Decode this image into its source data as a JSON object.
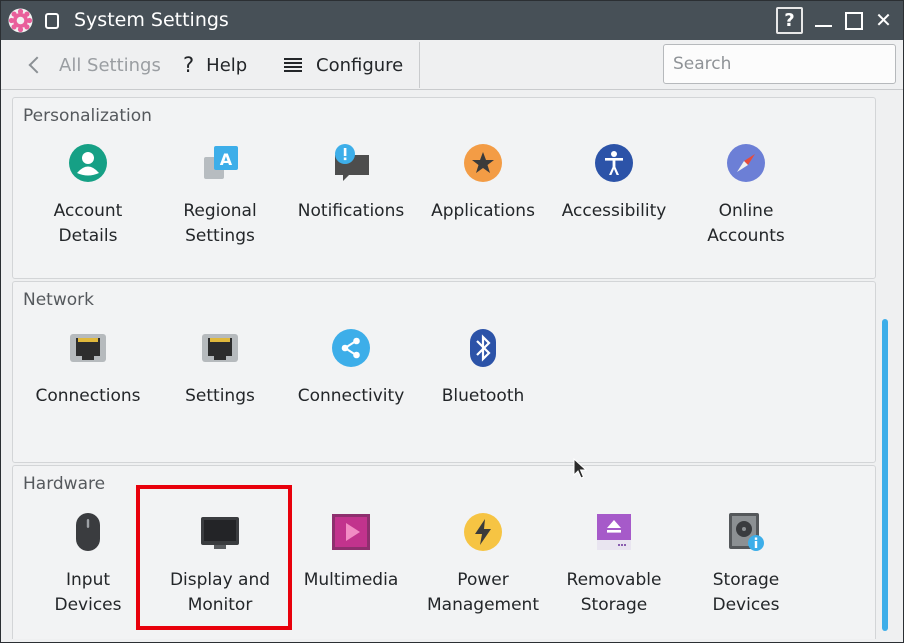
{
  "window": {
    "title": "System Settings"
  },
  "titlebar": {
    "help_label": "?",
    "close_label": "✕"
  },
  "toolbar": {
    "back_label": "All Settings",
    "help_label": "Help",
    "configure_label": "Configure",
    "search_placeholder": "Search"
  },
  "groups": [
    {
      "title": "Personalization",
      "items": [
        {
          "label": "Account\nDetails",
          "icon": "account-details-icon"
        },
        {
          "label": "Regional\nSettings",
          "icon": "regional-settings-icon"
        },
        {
          "label": "Notifications",
          "icon": "notifications-icon"
        },
        {
          "label": "Applications",
          "icon": "applications-icon"
        },
        {
          "label": "Accessibility",
          "icon": "accessibility-icon"
        },
        {
          "label": "Online\nAccounts",
          "icon": "online-accounts-icon"
        }
      ]
    },
    {
      "title": "Network",
      "items": [
        {
          "label": "Connections",
          "icon": "ethernet-port-icon"
        },
        {
          "label": "Settings",
          "icon": "ethernet-port-icon"
        },
        {
          "label": "Connectivity",
          "icon": "share-icon"
        },
        {
          "label": "Bluetooth",
          "icon": "bluetooth-icon"
        }
      ]
    },
    {
      "title": "Hardware",
      "items": [
        {
          "label": "Input\nDevices",
          "icon": "mouse-icon"
        },
        {
          "label": "Display and\nMonitor",
          "icon": "monitor-icon"
        },
        {
          "label": "Multimedia",
          "icon": "multimedia-icon"
        },
        {
          "label": "Power\nManagement",
          "icon": "power-icon"
        },
        {
          "label": "Removable\nStorage",
          "icon": "removable-storage-icon"
        },
        {
          "label": "Storage\nDevices",
          "icon": "storage-devices-icon"
        }
      ]
    }
  ],
  "colors": {
    "accent": "#3daee9",
    "titlebar": "#475057",
    "highlight": "#e8000b"
  }
}
